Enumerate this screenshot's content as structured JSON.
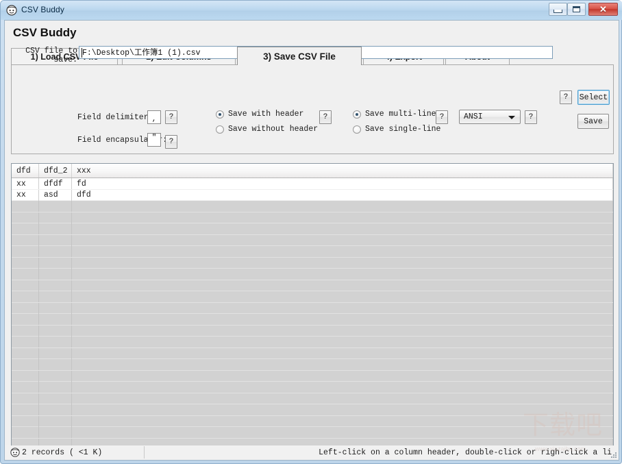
{
  "window": {
    "title": "CSV Buddy",
    "icon": "smiley-face-icon",
    "minimize_label": "",
    "maximize_label": "",
    "close_label": "✕"
  },
  "page": {
    "heading": "CSV Buddy"
  },
  "tabs": [
    {
      "label": "1) Load CSV File",
      "active": false
    },
    {
      "label": "2) Edit Columns",
      "active": false
    },
    {
      "label": "3) Save CSV File",
      "active": true
    },
    {
      "label": "4) Export",
      "active": false
    },
    {
      "label": "About",
      "active": false
    }
  ],
  "save_panel": {
    "csv_file_label": "CSV file to save:",
    "csv_file_value": "F:\\Desktop\\工作簿1 (1).csv",
    "csv_file_help": "?",
    "select_button": "Select",
    "save_button": "Save",
    "field_delimiter_label": "Field delimiter:",
    "field_delimiter_value": ",",
    "field_delimiter_help": "?",
    "field_encapsulator_label": "Field encapsulator:",
    "field_encapsulator_value": "\"",
    "field_encapsulator_help": "?",
    "header_options": [
      {
        "label": "Save with header",
        "checked": true
      },
      {
        "label": "Save without header",
        "checked": false
      }
    ],
    "header_help": "?",
    "line_options": [
      {
        "label": "Save multi-line",
        "checked": true
      },
      {
        "label": "Save single-line",
        "checked": false
      }
    ],
    "line_help": "?",
    "encoding_value": "ANSI",
    "encoding_help": "?"
  },
  "grid": {
    "columns": [
      "dfd",
      "dfd_2",
      "xxx"
    ],
    "rows": [
      [
        "xx",
        "dfdf",
        "fd"
      ],
      [
        "xx",
        "asd",
        "dfd"
      ]
    ],
    "empty_row_count": 23
  },
  "status": {
    "icon": "smiley-face-icon",
    "records_text": "2 records ( <1 K)",
    "hint_text": "Left-click on a column header, double-click or righ-click a li"
  },
  "watermark": {
    "text": "下载吧",
    "url": "www.xiazaiba.com"
  },
  "colors": {
    "titlebar": "#bcd8ef",
    "close_button": "#c2372c",
    "client_bg": "#f0f0f0",
    "grid_empty": "#d2d2d2",
    "focus_outline": "#4f9fd0"
  }
}
